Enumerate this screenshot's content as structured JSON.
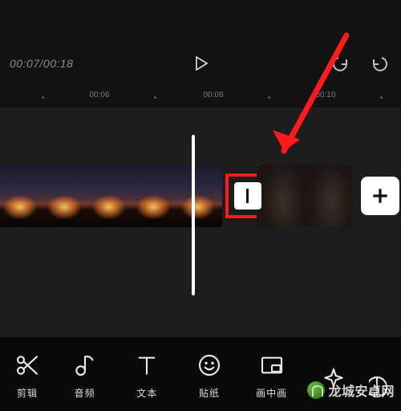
{
  "player": {
    "timecode": "00:07/00:18",
    "play_label": "play",
    "undo_label": "undo",
    "redo_label": "redo"
  },
  "ruler": {
    "labels": [
      "00:06",
      "00:08",
      "00:10"
    ]
  },
  "timeline": {
    "transition_icon": "transition-icon",
    "add_clip_label": "+"
  },
  "annotation": {
    "arrow_color": "#ff1b1b"
  },
  "toolbar": {
    "items": [
      {
        "key": "cut",
        "label": "剪辑",
        "icon": "scissors-icon"
      },
      {
        "key": "audio",
        "label": "音频",
        "icon": "music-note-icon"
      },
      {
        "key": "text",
        "label": "文本",
        "icon": "text-t-icon"
      },
      {
        "key": "sticker",
        "label": "贴纸",
        "icon": "smiley-icon"
      },
      {
        "key": "pip",
        "label": "画中画",
        "icon": "pip-icon"
      },
      {
        "key": "effect",
        "label": "",
        "icon": "sparkle-icon"
      }
    ]
  },
  "watermark": {
    "text": "龙城安卓网"
  }
}
